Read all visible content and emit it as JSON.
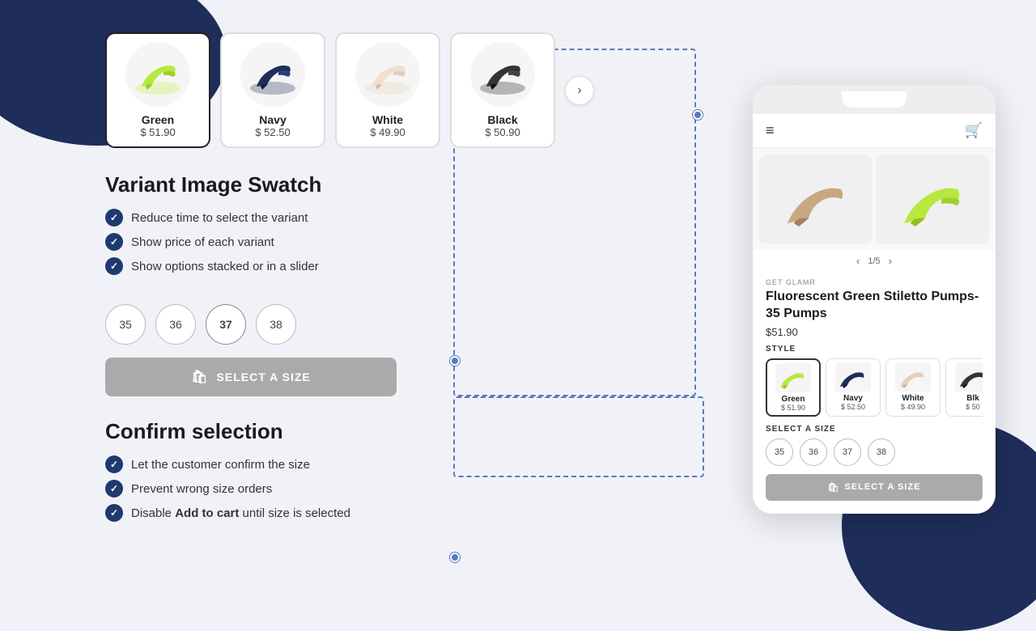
{
  "background": {
    "shape_top_left": "decorative",
    "shape_bottom_right": "decorative"
  },
  "swatches_section": {
    "variants": [
      {
        "id": "green",
        "name": "Green",
        "price": "$ 51.90",
        "selected": true,
        "color": "#b8e840"
      },
      {
        "id": "navy",
        "name": "Navy",
        "price": "$ 52.50",
        "selected": false,
        "color": "#1e2d5a"
      },
      {
        "id": "white",
        "name": "White",
        "price": "$ 49.90",
        "selected": false,
        "color": "#f0e0d0"
      },
      {
        "id": "black",
        "name": "Black",
        "price": "$ 50.90",
        "selected": false,
        "color": "#222"
      }
    ],
    "next_button": "›"
  },
  "variant_section": {
    "title": "Variant Image Swatch",
    "features": [
      "Reduce time to select the variant",
      "Show price of each variant",
      "Show options stacked or in a slider"
    ]
  },
  "size_section": {
    "label": "SELECT A SIZE",
    "sizes": [
      "35",
      "36",
      "37",
      "38"
    ],
    "selected_size": "37"
  },
  "confirm_section": {
    "title": "Confirm selection",
    "features": [
      {
        "text": "Let the customer confirm the size",
        "bold": false
      },
      {
        "text": "Prevent wrong size orders",
        "bold": false
      },
      {
        "text_before": "Disable ",
        "bold_text": "Add to cart",
        "text_after": " until size is selected",
        "has_bold": true
      }
    ]
  },
  "phone": {
    "brand": "GET GLAMR",
    "product_name": "Fluorescent Green Stiletto Pumps- 35 Pumps",
    "price": "$51.90",
    "pagination": "1/5",
    "style_label": "STYLE",
    "size_label": "SELECT A SIZE",
    "select_btn_label": "SELECT A SIZE",
    "variants": [
      {
        "id": "green",
        "name": "Green",
        "price": "$ 51.90",
        "selected": true
      },
      {
        "id": "navy",
        "name": "Navy",
        "price": "$ 52.50",
        "selected": false
      },
      {
        "id": "white",
        "name": "White",
        "price": "$ 49.90",
        "selected": false
      },
      {
        "id": "black",
        "name": "Blk",
        "price": "$ 50",
        "selected": false
      }
    ],
    "sizes": [
      "35",
      "36",
      "37",
      "38"
    ]
  }
}
